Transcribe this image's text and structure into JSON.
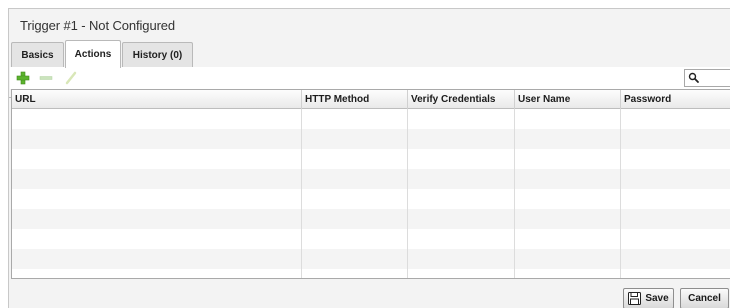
{
  "window": {
    "title": "Trigger #1 - Not Configured"
  },
  "tabs": [
    {
      "label": "Basics",
      "active": false
    },
    {
      "label": "Actions",
      "active": true
    },
    {
      "label": "History (0)",
      "active": false
    }
  ],
  "toolbar": {
    "add_icon": "plus-icon",
    "remove_icon": "minus-icon",
    "edit_icon": "pencil-icon",
    "search_icon": "magnifier-icon",
    "search_value": ""
  },
  "table": {
    "columns": [
      "URL",
      "HTTP Method",
      "Verify Credentials",
      "User Name",
      "Password"
    ],
    "rows": []
  },
  "footer": {
    "save_label": "Save",
    "save_icon": "floppy-disk-icon",
    "cancel_label": "Cancel"
  },
  "colors": {
    "add_icon": "#5cb32e",
    "disabled_icon": "#b8d9a8",
    "row_alt": "#f4f4f4"
  }
}
